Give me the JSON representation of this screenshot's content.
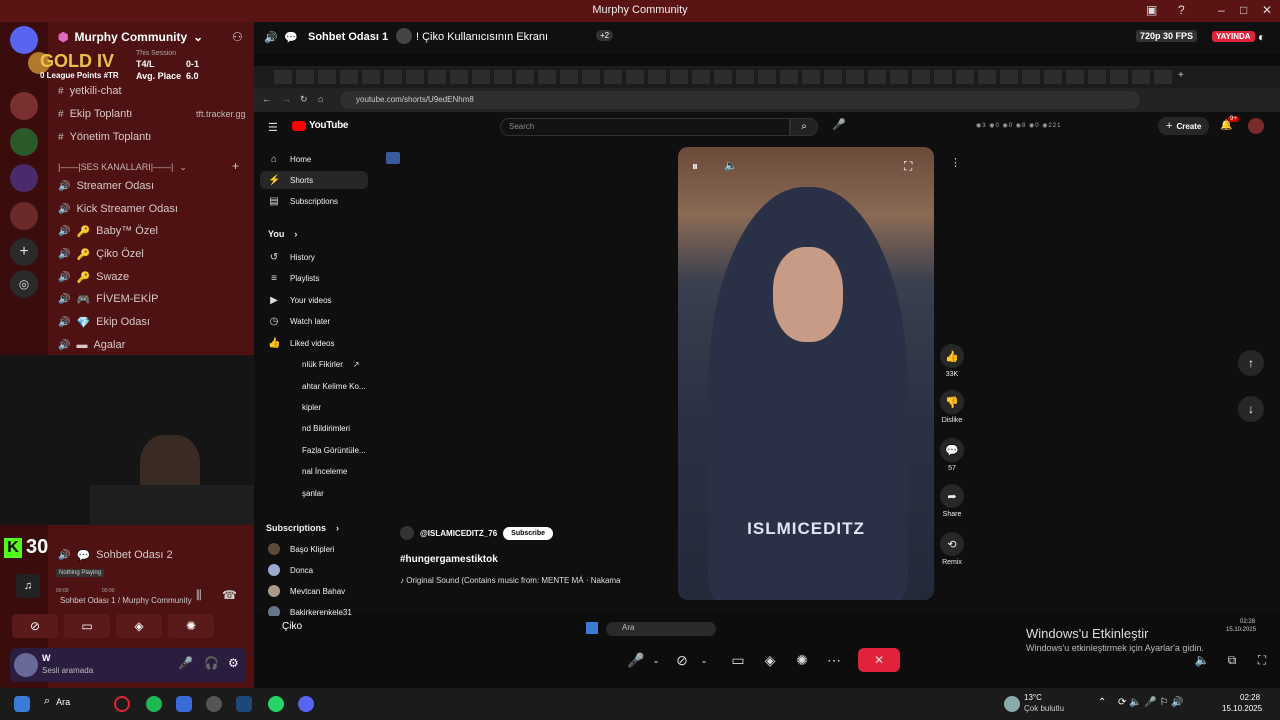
{
  "window": {
    "title": "Murphy Community"
  },
  "server": {
    "name": "Murphy Community"
  },
  "overlay": {
    "rank": "GOLD IV",
    "session_label": "This Session",
    "lp": "0 League Points #TR",
    "tl_label": "T4/L",
    "tl_value": "0-1",
    "avg_label": "Avg. Place",
    "avg_value": "6.0",
    "tracker": "tft.tracker.gg",
    "kick_count": "30"
  },
  "channels": {
    "text": [
      "yetkili-chat",
      "Ekip Toplantı",
      "Yönetim Toplantı"
    ],
    "voice_category": "|——|SES KANALLARI|——|",
    "voice": [
      "Streamer Odası",
      "Kick Streamer Odası",
      "Baby™ Özel",
      "Çiko Özel",
      "Swaze",
      "FİVEM-EKİP",
      "Ekip Odası",
      "Agalar"
    ],
    "sohbet": "Sohbet Odası 2"
  },
  "player": {
    "status": "Nothing Playing",
    "time_start": "00:00",
    "time_end": "00:00",
    "voice_path": "Sohbet Odası 1 / Murphy Community"
  },
  "user": {
    "name": "W",
    "status": "Sesli aramada"
  },
  "call_header": {
    "channel": "Sohbet Odası 1",
    "screen": "! Çiko Kullanıcısının Ekranı",
    "extra": "+2",
    "quality": "720p 30 FPS",
    "live": "YAYINDA"
  },
  "browser": {
    "url": "youtube.com/shorts/U9edENhm8"
  },
  "youtube": {
    "search_placeholder": "Search",
    "create": "Create",
    "notif": "9+",
    "nav_main": [
      "Home",
      "Shorts",
      "Subscriptions"
    ],
    "you": "You",
    "nav_you": [
      "History",
      "Playlists",
      "Your videos",
      "Watch later",
      "Liked videos"
    ],
    "nav_partial": [
      "nlük Fikirler",
      "ahtar Kelime Ko...",
      "kipler",
      "nd Bildirimleri",
      "Fazla Görüntüle...",
      "nal İnceleme",
      "şanlar"
    ],
    "subscriptions": "Subscriptions",
    "subs": [
      "Başo Klipleri",
      "Donca",
      "Mevtcan Bahav",
      "Bakirkerenkele31"
    ],
    "channel": "@ISLAMICEDITZ_76",
    "subscribe": "Subscribe",
    "title": "#hungergamestiktok",
    "sound": "♪ Original Sound (Contains music from: MENTE MÁ · Nakama",
    "watermark": "ISLMICEDITZ",
    "likes": "33K",
    "dislike": "Dislike",
    "comments": "57",
    "share": "Share",
    "remix": "Remix"
  },
  "call_user": "Çiko",
  "activation": {
    "title": "Windows'u Etkinleştir",
    "sub": "Windows'u etkinleştirmek için Ayarlar'a gidin."
  },
  "inner_taskbar": {
    "search": "Ara",
    "time": "02:28",
    "date": "15.10.2025"
  },
  "taskbar": {
    "search": "Ara",
    "temp": "13°C",
    "weather": "Çok bulutlu",
    "time": "02:28",
    "date": "15.10.2025"
  },
  "colors": {
    "youtube_red": "#ff0000",
    "kick_green": "#53fc18",
    "live_red": "#e0233b",
    "gold": "#e8c34a"
  }
}
